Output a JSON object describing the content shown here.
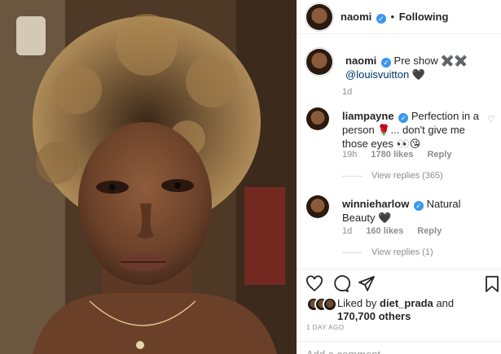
{
  "header": {
    "username": "naomi",
    "separator": "•",
    "follow_status": "Following"
  },
  "caption": {
    "username": "naomi",
    "text": "Pre show ✖️✖️",
    "mention": "@louisvuitton",
    "emoji": "🖤",
    "time": "1d"
  },
  "comments": [
    {
      "username": "liampayne",
      "text": "Perfection in a person 🌹... don't give me those eyes 👀😘",
      "time": "19h",
      "likes": "1780 likes",
      "reply": "Reply",
      "view_replies": "View replies (365)"
    },
    {
      "username": "winnieharlow",
      "text": "Natural Beauty 🖤",
      "time": "1d",
      "likes": "160 likes",
      "reply": "Reply",
      "view_replies": "View replies (1)"
    }
  ],
  "likes": {
    "prefix": "Liked by",
    "user": "diet_prada",
    "and": "and",
    "count": "170,700 others"
  },
  "post_age": "1 DAY AGO",
  "add_comment": {
    "placeholder": "Add a comment..."
  },
  "icons": {
    "verified": "verified-badge-icon",
    "like": "heart-icon",
    "comment": "comment-bubble-icon",
    "share": "paper-plane-icon",
    "save": "bookmark-icon",
    "comment_like": "small-heart-icon"
  },
  "colors": {
    "verified_blue": "#3897f0",
    "text": "#262626",
    "muted": "#8e8e8e",
    "border": "#efefef"
  }
}
